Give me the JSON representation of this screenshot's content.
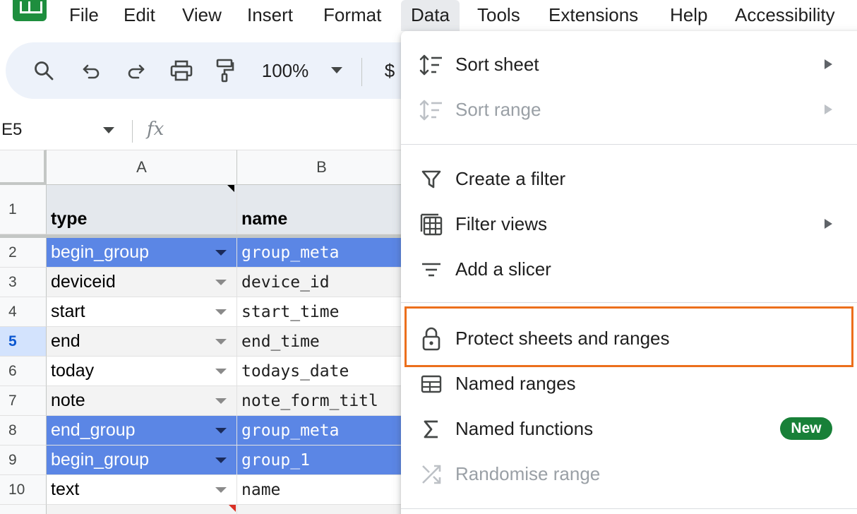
{
  "menubar": {
    "items": [
      "File",
      "Edit",
      "View",
      "Insert",
      "Format",
      "Data",
      "Tools",
      "Extensions",
      "Help",
      "Accessibility"
    ],
    "active": "Data"
  },
  "toolbar": {
    "zoom": "100%",
    "currency": "$",
    "icons": [
      "search-icon",
      "undo-icon",
      "redo-icon",
      "print-icon",
      "paint-format-icon"
    ]
  },
  "formula_bar": {
    "name_box": "E5",
    "fx": "fx"
  },
  "grid": {
    "columns": [
      "A",
      "B"
    ],
    "header_row": {
      "row": "1",
      "a": "type",
      "b": "name"
    },
    "rows": [
      {
        "row": "2",
        "a": "begin_group",
        "b": "group_meta",
        "style": "group"
      },
      {
        "row": "3",
        "a": "deviceid",
        "b": "device_id",
        "style": "plain"
      },
      {
        "row": "4",
        "a": "start",
        "b": "start_time",
        "style": "white"
      },
      {
        "row": "5",
        "a": "end",
        "b": "end_time",
        "style": "plain",
        "selected": true
      },
      {
        "row": "6",
        "a": "today",
        "b": "todays_date",
        "style": "white"
      },
      {
        "row": "7",
        "a": "note",
        "b": "note_form_titl",
        "style": "plain"
      },
      {
        "row": "8",
        "a": "end_group",
        "b": "group_meta",
        "style": "group"
      },
      {
        "row": "9",
        "a": "begin_group",
        "b": "group_1",
        "style": "group"
      },
      {
        "row": "10",
        "a": "text",
        "b": "name",
        "style": "white"
      }
    ]
  },
  "data_menu": {
    "items": [
      {
        "label": "Sort sheet",
        "icon": "sort-icon",
        "submenu": true,
        "disabled": false
      },
      {
        "label": "Sort range",
        "icon": "sort-icon",
        "submenu": true,
        "disabled": true
      },
      {
        "label": "Create a filter",
        "icon": "filter-icon",
        "submenu": false,
        "disabled": false
      },
      {
        "label": "Filter views",
        "icon": "filter-views-icon",
        "submenu": true,
        "disabled": false
      },
      {
        "label": "Add a slicer",
        "icon": "slicer-icon",
        "submenu": false,
        "disabled": false
      },
      {
        "label": "Protect sheets and ranges",
        "icon": "lock-icon",
        "submenu": false,
        "disabled": false,
        "highlighted": true
      },
      {
        "label": "Named ranges",
        "icon": "named-ranges-icon",
        "submenu": false,
        "disabled": false
      },
      {
        "label": "Named functions",
        "icon": "sigma-icon",
        "submenu": false,
        "disabled": false,
        "badge": "New"
      },
      {
        "label": "Randomise range",
        "icon": "shuffle-icon",
        "submenu": false,
        "disabled": true
      }
    ]
  },
  "colors": {
    "group_fill": "#5b86e5",
    "highlight_border": "#ec6f1c",
    "badge_fill": "#188038",
    "toolbar_bg": "#edf2fa"
  }
}
